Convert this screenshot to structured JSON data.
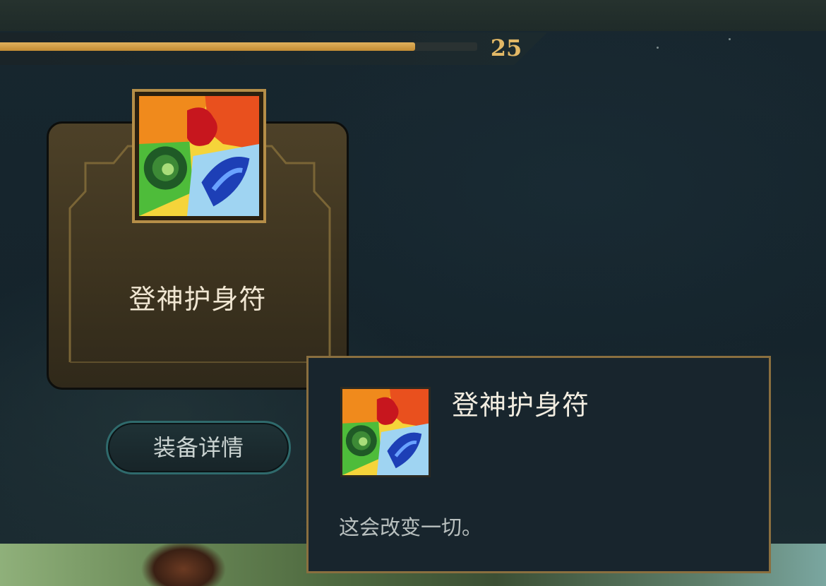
{
  "level": {
    "value": "25",
    "progress": 0.87
  },
  "item": {
    "name": "登神护身符",
    "icon": "elemental-swirl-icon"
  },
  "details_button": {
    "label": "装备详情"
  },
  "tooltip": {
    "title": "登神护身符",
    "description": "这会改变一切。",
    "icon": "elemental-swirl-icon"
  },
  "colors": {
    "accent_gold": "#e2b866",
    "frame_gold": "#b58e48",
    "button_teal": "#2f6a6c",
    "tooltip_border": "#8a6f3f"
  }
}
